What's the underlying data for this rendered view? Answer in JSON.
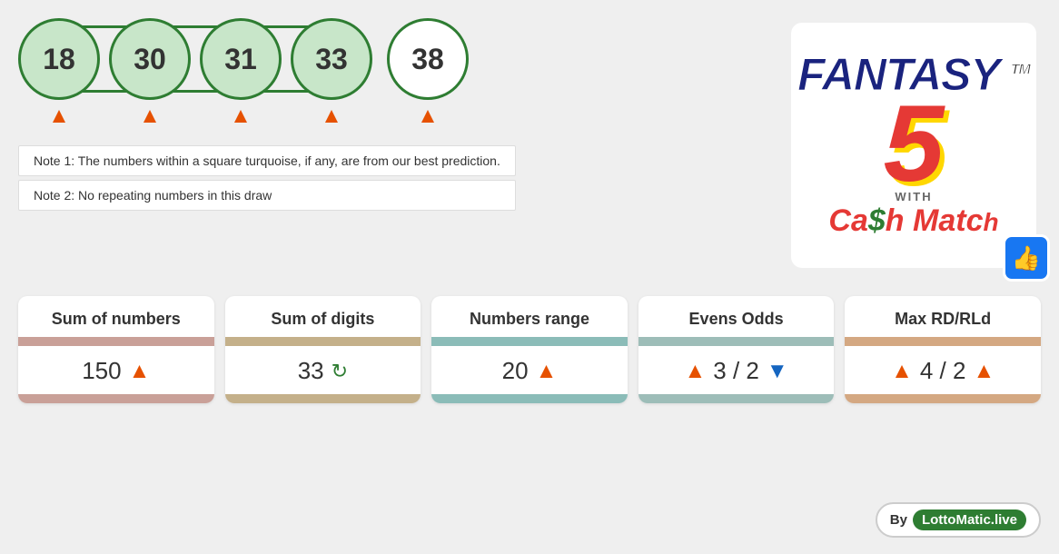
{
  "balls": [
    {
      "number": "18",
      "style": "green"
    },
    {
      "number": "30",
      "style": "green"
    },
    {
      "number": "31",
      "style": "green"
    },
    {
      "number": "33",
      "style": "green"
    },
    {
      "number": "38",
      "style": "white"
    }
  ],
  "notes": [
    "Note 1: The numbers within a square turquoise, if any, are from our best prediction.",
    "Note 2: No repeating numbers in this draw"
  ],
  "logo": {
    "fantasy": "FANTASY",
    "number": "5",
    "with": "WITH",
    "cash_match": "Ca$h Matc"
  },
  "stats": [
    {
      "title": "Sum of numbers",
      "value": "150",
      "has_up": true,
      "has_down": false,
      "bar_color": "pink",
      "value_suffix": ""
    },
    {
      "title": "Sum of digits",
      "value": "33",
      "has_up": false,
      "has_down": false,
      "has_refresh": true,
      "bar_color": "tan",
      "value_suffix": ""
    },
    {
      "title": "Numbers range",
      "value": "20",
      "has_up": true,
      "has_down": false,
      "bar_color": "teal",
      "value_suffix": ""
    },
    {
      "title": "Evens Odds",
      "value": "3 / 2",
      "has_up": true,
      "has_down": true,
      "bar_color": "sage",
      "value_suffix": ""
    },
    {
      "title": "Max RD/RLd",
      "value": "4 / 2",
      "has_up": true,
      "has_down": false,
      "has_up_end": true,
      "bar_color": "peach",
      "value_suffix": ""
    }
  ],
  "by": "By",
  "brand": "LottoMatic.live"
}
